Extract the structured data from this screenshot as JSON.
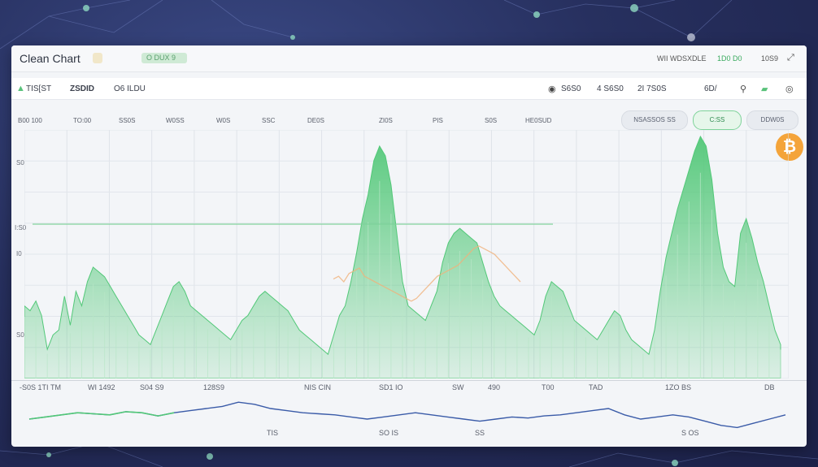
{
  "window": {
    "title": "Clean Chart",
    "pill_a": "",
    "pill_b": "O DUX 9"
  },
  "titlebar_right": {
    "left_text": "WII WDSXDLE",
    "value_a": "1D0 D0",
    "value_b": "10S9"
  },
  "toolbar": {
    "symbol": "TIS[ST",
    "price": "ZSDID",
    "change": "O6 ILDU",
    "stat_a": "S6S0",
    "stat_b": "4 S6S0",
    "stat_c": "2I 7S0S",
    "stat_d": "6D/"
  },
  "tabs": {
    "labels": [
      "B00 100",
      "TO:00",
      "SS0S",
      "W0SS",
      "W0S",
      "SSC",
      "DE0S",
      "ZI0S",
      "PIS",
      "S0S",
      "HE0SUD"
    ],
    "segments": [
      {
        "label": "NSASSOS SS",
        "active": false
      },
      {
        "label": "C:SS",
        "active": true
      },
      {
        "label": "DDW0S",
        "active": false
      }
    ]
  },
  "y_axis_labels": [
    "S0",
    "I:S0",
    "I0",
    "S0"
  ],
  "date_axis": [
    "-S0S 1TI",
    "TM",
    "WI 1492",
    "S04 S9",
    "128S9",
    "NIS CIN",
    "SD1 IO",
    "SW",
    "490",
    "T00",
    "TAD",
    "1ZO BS",
    "DB"
  ],
  "navigator_labels": [
    "TIS",
    "SO IS",
    "SS",
    "S OS"
  ],
  "colors": {
    "green": "#52c878",
    "orange": "#f0b27a",
    "blue": "#3a5ba8",
    "btc": "#f4a43a"
  },
  "chart_data": {
    "type": "area",
    "series": [
      {
        "values": [
          30,
          28,
          32,
          26,
          12,
          18,
          20,
          34,
          22,
          36,
          30,
          40,
          46,
          44,
          42,
          38,
          34,
          30,
          26,
          22,
          18,
          16,
          14,
          20,
          26,
          32,
          38,
          40,
          36,
          30,
          28,
          26,
          24,
          22,
          20,
          18,
          16,
          20,
          24,
          26,
          30,
          34,
          36,
          34,
          32,
          30,
          28,
          24,
          20,
          18,
          16,
          14,
          12,
          10,
          18,
          26,
          30,
          40,
          52,
          66,
          76,
          90,
          96,
          92,
          80,
          60,
          40,
          30,
          28,
          26,
          24,
          30,
          36,
          48,
          56,
          60,
          62,
          60,
          58,
          56,
          48,
          40,
          34,
          30,
          28,
          26,
          24,
          22,
          20,
          18,
          24,
          34,
          40,
          38,
          36,
          30,
          24,
          22,
          20,
          18,
          16,
          20,
          24,
          28,
          26,
          20,
          16,
          14,
          12,
          10,
          20,
          36,
          50,
          60,
          70,
          78,
          86,
          94,
          100,
          96,
          82,
          60,
          46,
          40,
          38,
          60,
          66,
          58,
          48,
          40,
          30,
          20,
          14
        ]
      },
      {
        "values": [
          72,
          74,
          70,
          76,
          78,
          80,
          74,
          72,
          70,
          68,
          66,
          64,
          62,
          60,
          58,
          56,
          58,
          62,
          66,
          70,
          74,
          76,
          78,
          80,
          82,
          86,
          90,
          94,
          96,
          94,
          92,
          90,
          86,
          82,
          78,
          74,
          70
        ]
      }
    ],
    "navigator": [
      20,
      22,
      24,
      26,
      25,
      24,
      27,
      26,
      23,
      26,
      28,
      30,
      32,
      36,
      34,
      30,
      28,
      26,
      25,
      24,
      22,
      20,
      22,
      24,
      26,
      24,
      22,
      20,
      18,
      20,
      22,
      21,
      23,
      24,
      26,
      28,
      30,
      24,
      20,
      22,
      24,
      22,
      18,
      14,
      12,
      16,
      20,
      24
    ]
  }
}
